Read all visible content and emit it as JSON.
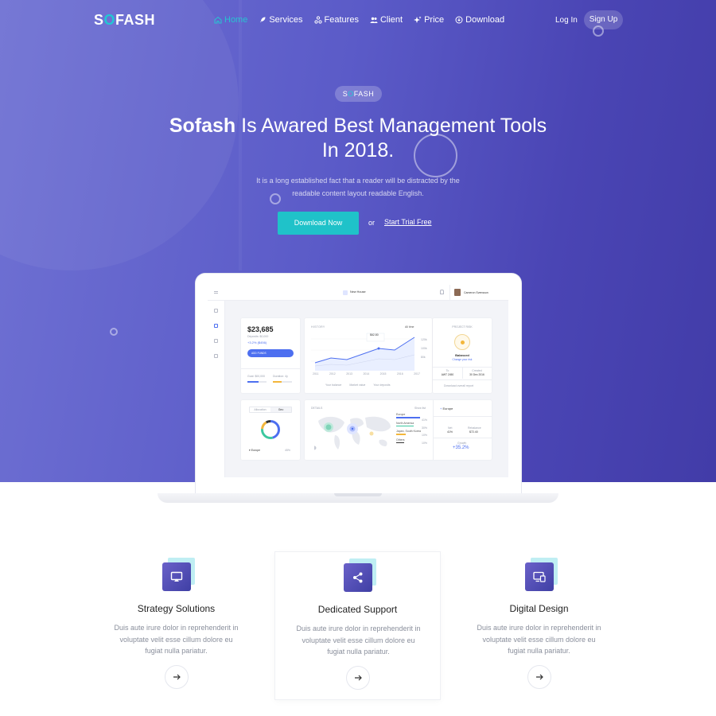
{
  "brand": {
    "logo_prefix": "S",
    "logo_accent": "O",
    "logo_suffix": "FASH"
  },
  "nav": {
    "items": [
      {
        "label": "Home",
        "icon": "home-icon",
        "active": true
      },
      {
        "label": "Services",
        "icon": "rocket-icon"
      },
      {
        "label": "Features",
        "icon": "nodes-icon"
      },
      {
        "label": "Client",
        "icon": "users-icon"
      },
      {
        "label": "Price",
        "icon": "sparkle-icon"
      },
      {
        "label": "Download",
        "icon": "download-icon"
      }
    ],
    "login": "Log In",
    "signup": "Sign Up"
  },
  "hero": {
    "badge_prefix": "S",
    "badge_accent": "O",
    "badge_suffix": "FASH",
    "title_bold": "Sofash",
    "title_rest_1": " Is Awared Best Management Tools",
    "title_rest_2": "In 2018.",
    "subtitle": "It is a long established fact that a reader will be distracted by the readable content layout readable English.",
    "cta_primary": "Download Now",
    "or": "or",
    "cta_secondary": "Start Trial Free"
  },
  "dashboard": {
    "topbar_center": "New House",
    "user": "Cameron Svensson",
    "balance": "$23,685",
    "balance_sub": "Deposits: $0,000",
    "balance_change": "+3.2% ($456)",
    "add_funds": "ADD FUNDS",
    "goal": "Goal: $00,000",
    "duration": "Duration: 4y",
    "history_label": "HISTORY",
    "history_range": "All time",
    "chart_years": [
      "2011",
      "2012",
      "2013",
      "2014",
      "2015",
      "2016",
      "2017"
    ],
    "chart_y": [
      "120k",
      "100k",
      "80k"
    ],
    "tooltip": "$62.80",
    "legend": [
      "Your balance",
      "Market value",
      "Your deposits"
    ],
    "project_risk": "PROJECT RISK",
    "risk_value": "Balanced",
    "risk_link": "Change your risk",
    "stat1_label": "To",
    "stat1_value": "AWT 2450",
    "stat2_label": "Created",
    "stat2_value": "30 Dec 2016",
    "download_report": "Download overall report",
    "tabs": [
      "Allocation",
      "Geo"
    ],
    "donut_label": "Europe",
    "donut_pct": "45%",
    "map_label": "DETAILS",
    "map_link": "Show list",
    "regions": [
      {
        "name": "Europe",
        "pct": "41%"
      },
      {
        "name": "North America",
        "pct": "30%"
      },
      {
        "name": "Japan, South Korea",
        "pct": "10%"
      },
      {
        "name": "Others",
        "pct": "10%"
      }
    ],
    "europe_title": "Europe",
    "eu_stat1_label": "Net",
    "eu_stat1_value": "41%",
    "eu_stat2_label": "Rebalance",
    "eu_stat2_value": "$72.40",
    "growth_label": "Growth",
    "growth_value": "+35.2%"
  },
  "features": [
    {
      "title": "Strategy Solutions",
      "desc": "Duis aute irure dolor in reprehenderit in voluptate velit esse cillum dolore eu fugiat nulla pariatur.",
      "icon": "monitor-icon"
    },
    {
      "title": "Dedicated Support",
      "desc": "Duis aute irure dolor in reprehenderit in voluptate velit esse cillum dolore eu fugiat nulla pariatur.",
      "icon": "share-icon"
    },
    {
      "title": "Digital Design",
      "desc": "Duis aute irure dolor in reprehenderit in voluptate velit esse cillum dolore eu fugiat nulla pariatur.",
      "icon": "devices-icon"
    }
  ],
  "colors": {
    "accent": "#1fc2c9",
    "hero_start": "#6f71d3",
    "hero_end": "#423ca8",
    "icon_gradient": "#4f4bb5"
  }
}
